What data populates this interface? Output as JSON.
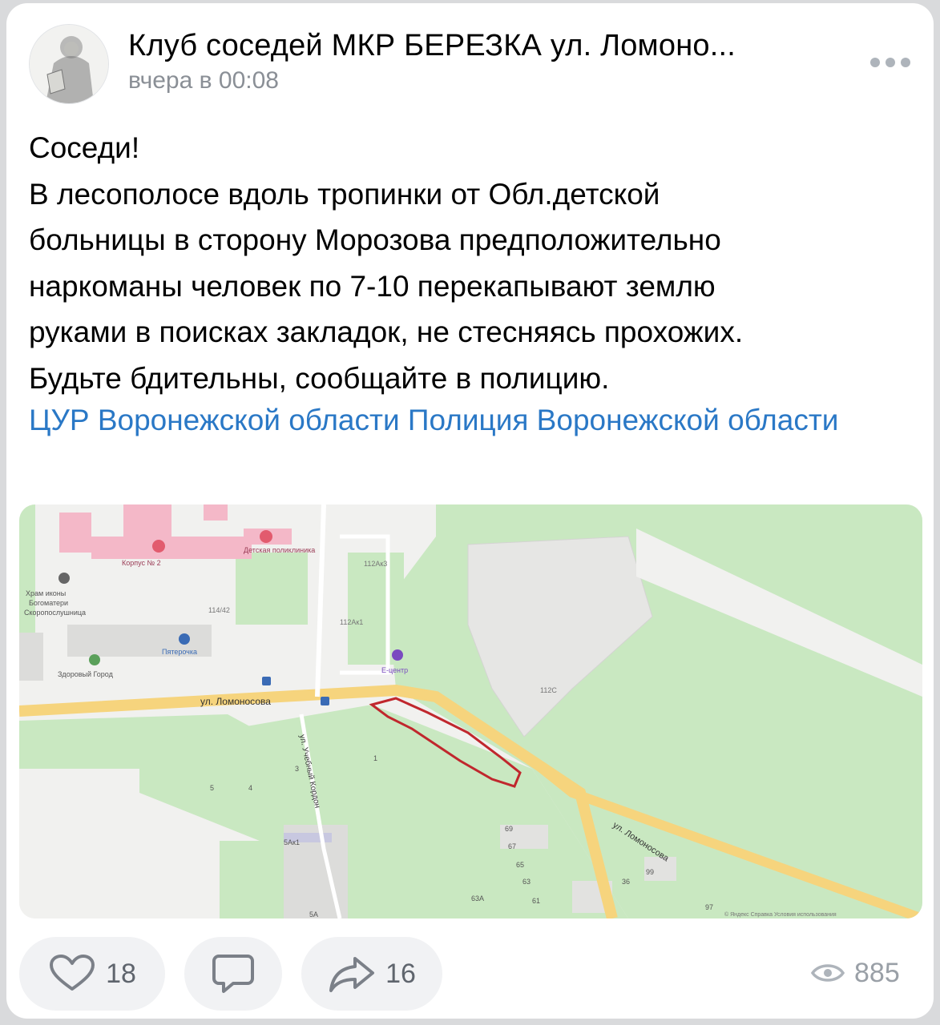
{
  "post": {
    "author": "Клуб соседей МКР БЕРЕЗКА ул. Ломоно...",
    "time": "вчера в 00:08",
    "text_lines": [
      "Соседи!",
      "В лесополосе вдоль тропинки от Обл.детской",
      "больницы в сторону Морозова предположительно",
      "наркоманы человек по 7-10 перекапывают землю",
      "руками в поисках закладок, не стесняясь прохожих.",
      "Будьте бдительны, сообщайте в полицию."
    ],
    "links": [
      "ЦУР Воронежской области",
      "Полиция Воронежской области"
    ]
  },
  "map": {
    "labels": {
      "korpus": "Корпус № 2",
      "clinic": "Детская поликлиника",
      "temple_1": "Храм иконы",
      "temple_2": "Богоматери",
      "temple_3": "Скоропослушница",
      "b114": "114/42",
      "pyaterochka": "Пятерочка",
      "zdorovy": "Здоровый Город",
      "b112ak3": "112Ак3",
      "b112ak1": "112Ак1",
      "ecentr": "Е-центр",
      "b112c": "112С",
      "street_main": "ул. Ломоносова",
      "street_side": "ул. Учебный Кордон",
      "street_diag": "ул. Ломоносова",
      "b5ak1": "5Ак1",
      "b5a": "5А",
      "b3": "3",
      "b4": "4",
      "b5": "5",
      "b1": "1",
      "b69": "69",
      "b67": "67",
      "b65": "65",
      "b63": "63",
      "b63a": "63А",
      "b61": "61",
      "b99": "99",
      "b36": "36",
      "b97": "97",
      "copyright": "© Яндекс  Справка  Условия использования"
    },
    "colors": {
      "green": "#c9e8c1",
      "road": "#f6d47d",
      "building": "#e4e4e2",
      "pink": "#f4b8c8",
      "outline": "#c0272d"
    }
  },
  "actions": {
    "likes": "18",
    "shares": "16",
    "views": "885"
  }
}
